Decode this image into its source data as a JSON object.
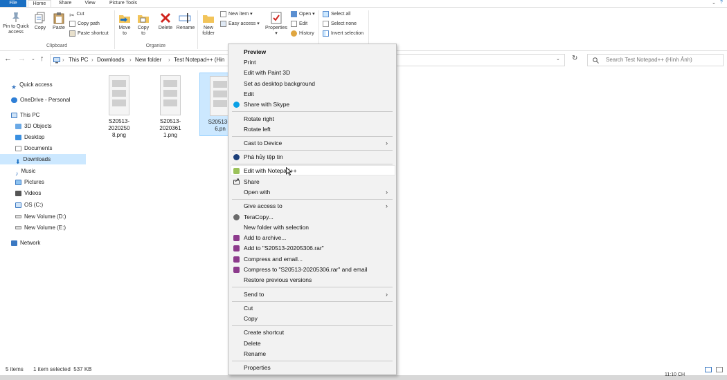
{
  "tabs": [
    "File",
    "Home",
    "Share",
    "View",
    "Picture Tools"
  ],
  "ribbon": {
    "clipboard": {
      "pin": "Pin to Quick access",
      "pin1": "Pin to Quick",
      "pin2": "access",
      "copy": "Copy",
      "paste": "Paste",
      "cut": "Cut",
      "copy_path": "Copy path",
      "paste_shortcut": "Paste shortcut",
      "label": "Clipboard"
    },
    "organize": {
      "move1": "Move",
      "move2": "to",
      "copy1": "Copy",
      "copy2": "to",
      "delete": "Delete",
      "rename": "Rename",
      "label": "Organize"
    },
    "new": {
      "folder1": "New",
      "folder2": "folder",
      "new_item": "New item",
      "easy_access": "Easy access",
      "label": "N"
    },
    "open": {
      "properties": "Properties",
      "open": "Open",
      "edit": "Edit",
      "history": "History"
    },
    "select": {
      "select_all": "Select all",
      "select_none": "Select none",
      "invert": "Invert selection"
    }
  },
  "address": {
    "crumbs": [
      "This PC",
      "Downloads",
      "New folder",
      "Test Notepad++ (Hin"
    ],
    "search_placeholder": "Search Test Notepad++ (Hình Ảnh)"
  },
  "nav": {
    "quick_access": "Quick access",
    "onedrive": "OneDrive - Personal",
    "this_pc": "This PC",
    "items": [
      "3D Objects",
      "Desktop",
      "Documents",
      "Downloads",
      "Music",
      "Pictures",
      "Videos",
      "OS (C:)",
      "New Volume (D:)",
      "New Volume (E:)"
    ],
    "network": "Network"
  },
  "files": [
    {
      "line1": "S20513-2020250",
      "line2": "8.png"
    },
    {
      "line1": "S20513-2020361",
      "line2": "1.png"
    },
    {
      "line1": "S20513-2",
      "line2": "6.pn"
    }
  ],
  "status": {
    "items": "5 items",
    "selected": "1 item selected  537 KB",
    "clock": "11:10 CH"
  },
  "menu": {
    "preview": "Preview",
    "print": "Print",
    "paint3d": "Edit with Paint 3D",
    "desktop_bg": "Set as desktop background",
    "edit": "Edit",
    "skype": "Share with Skype",
    "rotate_right": "Rotate right",
    "rotate_left": "Rotate left",
    "cast": "Cast to Device",
    "shred": "Phá hủy tệp tin",
    "notepad": "Edit with Notepad++",
    "share": "Share",
    "open_with": "Open with",
    "give_access": "Give access to",
    "teracopy": "TeraCopy...",
    "new_folder_sel": "New folder with selection",
    "add_archive": "Add to archive...",
    "add_rar": "Add to \"S20513-20205306.rar\"",
    "compress_email": "Compress and email...",
    "compress_rar_email": "Compress to \"S20513-20205306.rar\" and email",
    "restore": "Restore previous versions",
    "send_to": "Send to",
    "cut": "Cut",
    "copy": "Copy",
    "create_shortcut": "Create shortcut",
    "delete": "Delete",
    "rename": "Rename",
    "properties": "Properties"
  },
  "colors": {
    "accent": "#1a6fc2",
    "selection": "#cce8ff",
    "menu_bg": "#f2f2f2"
  }
}
